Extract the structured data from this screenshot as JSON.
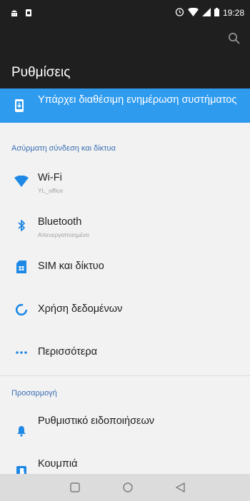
{
  "status_bar": {
    "time": "19:28",
    "icons": [
      "android-debug-icon",
      "sd-card-icon",
      "alarm-icon",
      "wifi-icon",
      "signal-icon",
      "battery-icon"
    ]
  },
  "toolbar": {
    "title": "Ρυθμίσεις",
    "search_icon": "search-icon"
  },
  "banner": {
    "text": "Υπάρχει διαθέσιμη ενημέρωση συστήματος",
    "icon": "system-update-icon",
    "color": "#2f9bef"
  },
  "sections": [
    {
      "header": "Ασύρματη σύνδεση και δίκτυα",
      "items": [
        {
          "title": "Wi-Fi",
          "summary": "YL_office",
          "icon": "wifi-icon"
        },
        {
          "title": "Bluetooth",
          "summary": "Απενεργοποιημένο",
          "icon": "bluetooth-icon"
        },
        {
          "title": "SIM και δίκτυο",
          "summary": "",
          "icon": "sim-card-icon"
        },
        {
          "title": "Χρήση δεδομένων",
          "summary": "",
          "icon": "data-usage-icon"
        },
        {
          "title": "Περισσότερα",
          "summary": "",
          "icon": "more-icon"
        }
      ]
    },
    {
      "header": "Προσαρμογή",
      "items": [
        {
          "title": "Ρυθμιστικό ειδοποιήσεων",
          "summary": "",
          "icon": "notification-bell-icon"
        },
        {
          "title": "Κουμπιά",
          "summary": "",
          "icon": "buttons-icon"
        }
      ]
    }
  ],
  "nav_bar": {
    "buttons": [
      "recents-icon",
      "home-icon",
      "back-icon"
    ]
  },
  "colors": {
    "accent": "#2f9bef",
    "section_header": "#3a6fb3",
    "toolbar_bg": "#1f1f1f",
    "page_bg": "#f2f2f2"
  }
}
